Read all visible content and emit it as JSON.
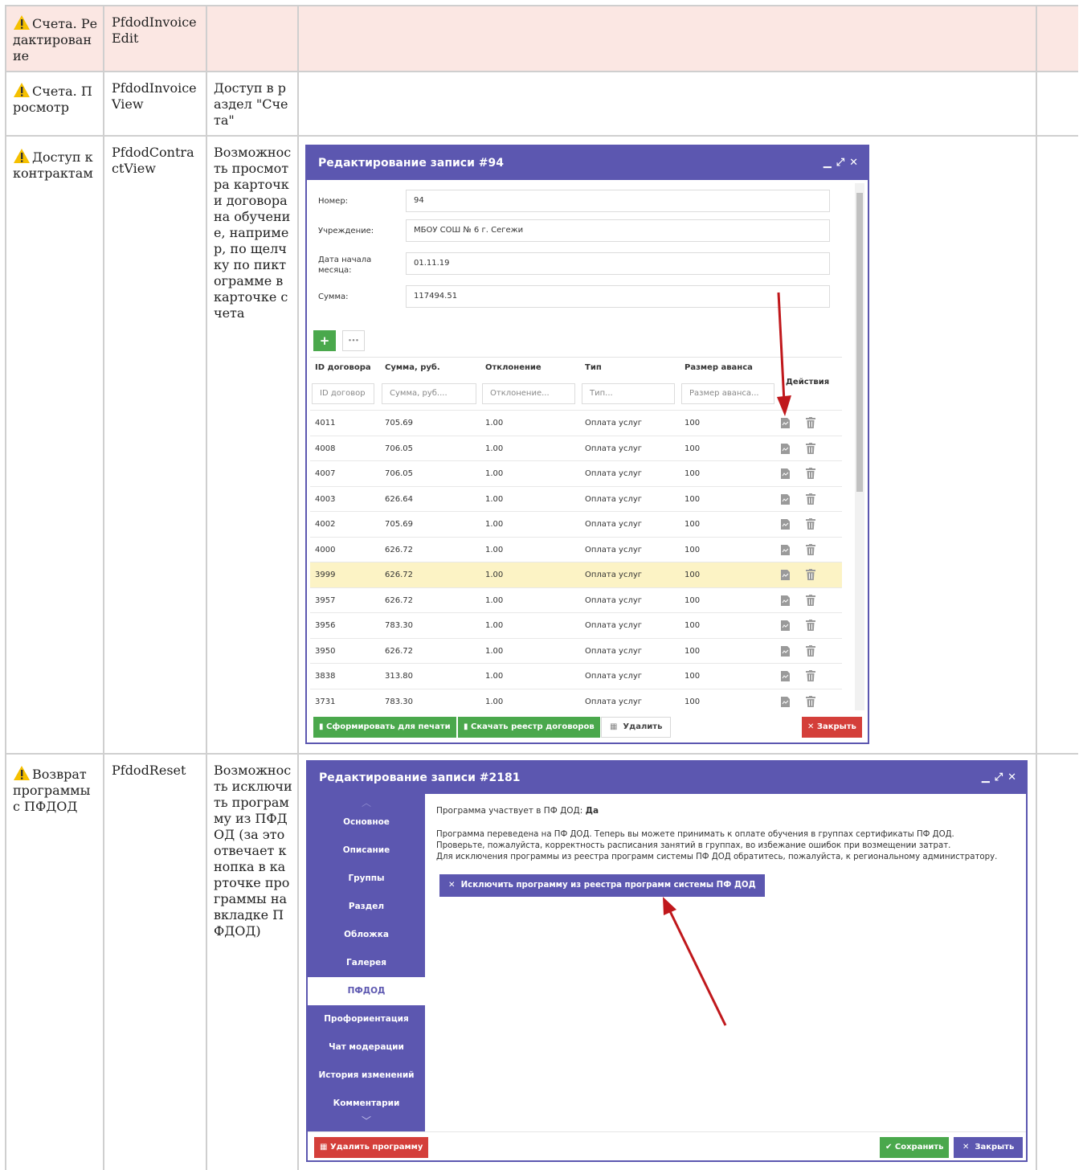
{
  "table": {
    "rows": [
      {
        "name": "Счета. Редактирование",
        "code": "PfdodInvoiceEdit",
        "desc": ""
      },
      {
        "name": "Счета. Просмотр",
        "code": "PfdodInvoiceView",
        "desc": "Доступ в раздел \"Счета\""
      },
      {
        "name": "Доступ к контрактам",
        "code": "PfdodContractView",
        "desc": "Возможность просмотра карточки договора на обучение, например, по щелчку по пиктограмме в карточке счета"
      },
      {
        "name": "Возврат программы с ПФДОД",
        "code": "PfdodReset",
        "desc": "Возможность исключить программу из ПФДОД (за это отвечает кнопка в карточке программы на вкладке ПФДОД)"
      }
    ]
  },
  "invoice_dialog": {
    "title": "Редактирование записи #94",
    "fields": [
      {
        "label": "Номер:",
        "value": "94"
      },
      {
        "label": "Учреждение:",
        "value": "МБОУ СОШ № 6 г. Сегежи"
      },
      {
        "label": "Дата начала месяца:",
        "value": "01.11.19"
      },
      {
        "label": "Сумма:",
        "value": "117494.51"
      }
    ],
    "add_symbol": "+",
    "more_symbol": "•••",
    "columns": [
      "ID договора",
      "Сумма, руб.",
      "Отклонение",
      "Тип",
      "Размер аванса",
      "Действия"
    ],
    "filters": [
      "ID договор",
      "Сумма, руб....",
      "Отклонение...",
      "Тип...",
      "Размер аванса..."
    ],
    "rows": [
      [
        "4011",
        "705.69",
        "1.00",
        "Оплата услуг",
        "100"
      ],
      [
        "4008",
        "706.05",
        "1.00",
        "Оплата услуг",
        "100"
      ],
      [
        "4007",
        "706.05",
        "1.00",
        "Оплата услуг",
        "100"
      ],
      [
        "4003",
        "626.64",
        "1.00",
        "Оплата услуг",
        "100"
      ],
      [
        "4002",
        "705.69",
        "1.00",
        "Оплата услуг",
        "100"
      ],
      [
        "4000",
        "626.72",
        "1.00",
        "Оплата услуг",
        "100"
      ],
      [
        "3999",
        "626.72",
        "1.00",
        "Оплата услуг",
        "100"
      ],
      [
        "3957",
        "626.72",
        "1.00",
        "Оплата услуг",
        "100"
      ],
      [
        "3956",
        "783.30",
        "1.00",
        "Оплата услуг",
        "100"
      ],
      [
        "3950",
        "626.72",
        "1.00",
        "Оплата услуг",
        "100"
      ],
      [
        "3838",
        "313.80",
        "1.00",
        "Оплата услуг",
        "100"
      ],
      [
        "3731",
        "783.30",
        "1.00",
        "Оплата услуг",
        "100"
      ]
    ],
    "highlight_row": "3999",
    "footer": {
      "print": "Сформировать для печати",
      "download": "Скачать реестр договоров",
      "delete": "Удалить",
      "close": "Закрыть"
    }
  },
  "program_dialog": {
    "title": "Редактирование записи #2181",
    "tabs": [
      "Основное",
      "Описание",
      "Группы",
      "Раздел",
      "Обложка",
      "Галерея",
      "ПФДОД",
      "Профориентация",
      "Чат модерации",
      "История изменений",
      "Комментарии"
    ],
    "active_tab": "ПФДОД",
    "status_label": "Программа участвует в ПФ ДОД:",
    "status_value": "Да",
    "info_lines": [
      "Программа переведена на ПФ ДОД. Теперь вы можете принимать к оплате обучения в группах сертификаты ПФ ДОД.",
      "Проверьте, пожалуйста, корректность расписания занятий в группах, во избежание ошибок при возмещении затрат.",
      "Для исключения программы из реестра программ системы ПФ ДОД обратитесь, пожалуйста, к региональному администратору."
    ],
    "exclude_button": "Исключить программу из реестра программ системы ПФ ДОД",
    "delete_button": "Удалить программу",
    "save_button": "Сохранить",
    "close_button": "Закрыть"
  },
  "colors": {
    "header_bg": "#fbe7e3",
    "dialog_accent": "#5c57b0",
    "green": "#4aa84c",
    "red": "#d43f3a",
    "arrow": "#c0181c",
    "highlight_row": "#fcf3c5"
  }
}
